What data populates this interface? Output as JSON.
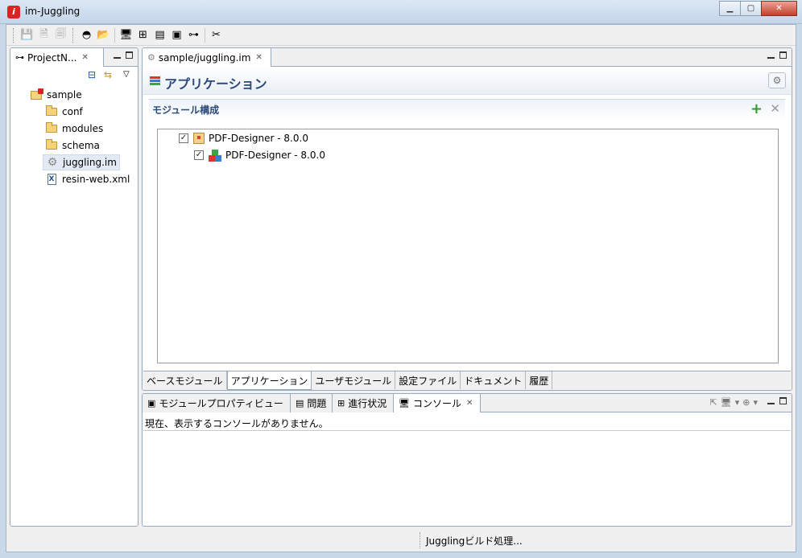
{
  "window": {
    "title": "im-Juggling"
  },
  "toolbar": {
    "icons": [
      "save-icon",
      "save-as-icon",
      "save-all-icon",
      "juggling-icon",
      "open-project-icon",
      "server-icon",
      "add-module-icon",
      "report-icon",
      "image-icon",
      "hierarchy-icon",
      "tools-icon"
    ]
  },
  "navigator": {
    "tab_label": "ProjectN...",
    "tree": [
      {
        "label": "sample",
        "icon": "project-icon",
        "level": 0
      },
      {
        "label": "conf",
        "icon": "folder-icon",
        "level": 1
      },
      {
        "label": "modules",
        "icon": "folder-icon",
        "level": 1
      },
      {
        "label": "schema",
        "icon": "folder-icon",
        "level": 1
      },
      {
        "label": "juggling.im",
        "icon": "gear-file-icon",
        "level": 1,
        "selected": true
      },
      {
        "label": "resin-web.xml",
        "icon": "xml-file-icon",
        "level": 1
      }
    ]
  },
  "editor": {
    "tab_label": "sample/juggling.im",
    "title": "アプリケーション",
    "section_title": "モジュール構成",
    "modules": [
      {
        "label": "PDF-Designer - 8.0.0",
        "checked": true,
        "level": 0
      },
      {
        "label": "PDF-Designer - 8.0.0",
        "checked": true,
        "level": 1
      }
    ],
    "bottom_tabs": [
      "ベースモジュール",
      "アプリケーション",
      "ユーザモジュール",
      "設定ファイル",
      "ドキュメント",
      "履歴"
    ],
    "active_bottom_tab": "アプリケーション"
  },
  "bottom_panel": {
    "tabs": [
      "モジュールプロパティビュー",
      "問題",
      "進行状況",
      "コンソール"
    ],
    "active_tab": "コンソール",
    "console_message": "現在、表示するコンソールがありません。"
  },
  "status": {
    "text": "Jugglingビルド処理..."
  },
  "colors": {
    "accent": "#2c4a79",
    "add_green": "#2e9c2e",
    "brand_red": "#dd2222"
  }
}
